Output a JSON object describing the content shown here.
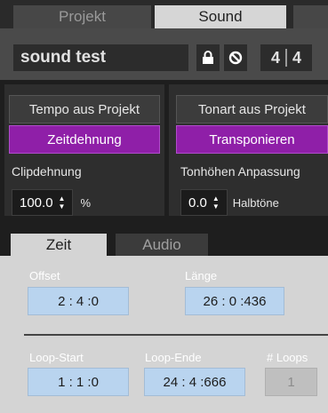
{
  "top_tabs": [
    {
      "label": "Projekt",
      "active": false
    },
    {
      "label": "Sound",
      "active": true
    },
    {
      "label": "",
      "active": false
    }
  ],
  "header": {
    "title": "sound test",
    "lock_icon": "lock-icon",
    "disable_icon": "no-entry-icon",
    "time_signature": {
      "numerator": "4",
      "denominator": "4"
    }
  },
  "tempo_panel": {
    "source_label": "Tempo aus Projekt",
    "mode_label": "Zeitdehnung",
    "param_label": "Clipdehnung",
    "value": "100.0",
    "unit": "%"
  },
  "key_panel": {
    "source_label": "Tonart aus Projekt",
    "mode_label": "Transponieren",
    "param_label": "Tonhöhen Anpassung",
    "value": "0.0",
    "unit": "Halbtöne"
  },
  "bottom_tabs": [
    {
      "label": "Zeit",
      "active": true
    },
    {
      "label": "Audio",
      "active": false
    }
  ],
  "zeit": {
    "offset_label": "Offset",
    "offset_value": "2 : 4 :0",
    "length_label": "Länge",
    "length_value": "26 : 0 :436",
    "loop_start_label": "Loop-Start",
    "loop_start_value": "1 : 1 :0",
    "loop_end_label": "Loop-Ende",
    "loop_end_value": "24 : 4 :666",
    "loops_label": "# Loops",
    "loops_value": "1"
  },
  "colors": {
    "accent_purple": "#8f1fa8",
    "field_blue": "#b9d4ef"
  }
}
